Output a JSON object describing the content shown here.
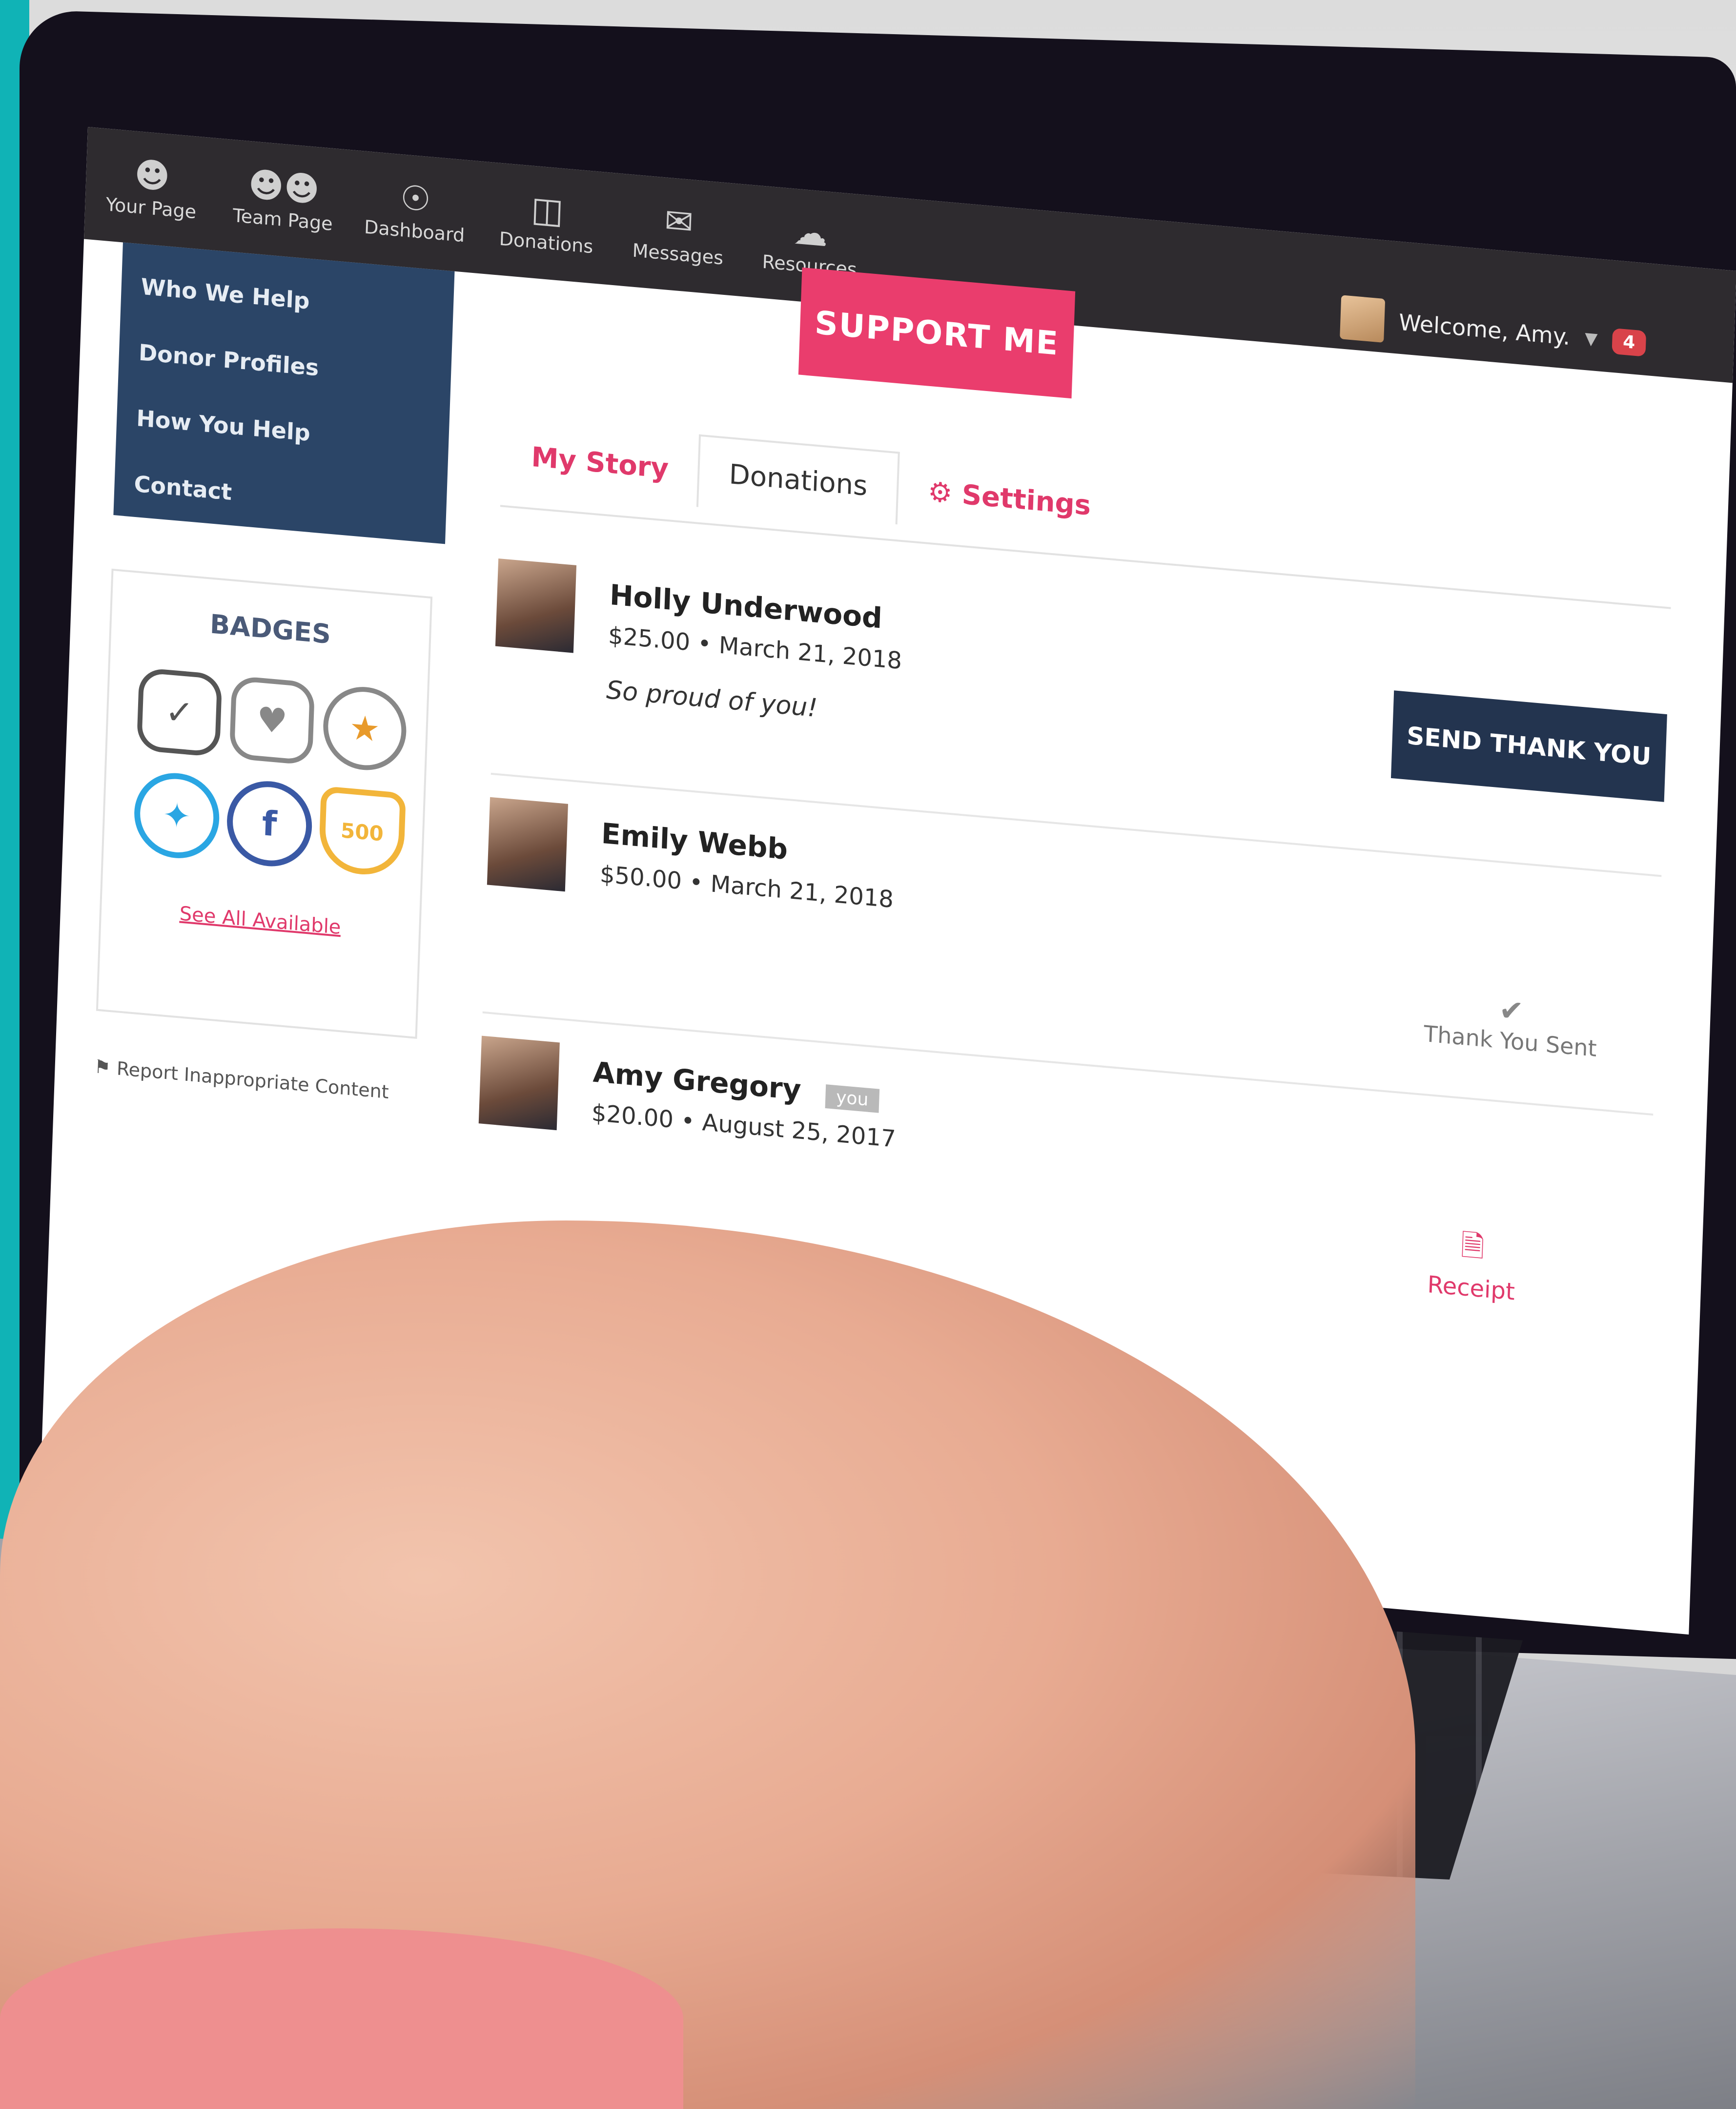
{
  "topnav": {
    "items": [
      {
        "label": "Your Page",
        "icon": "user-icon"
      },
      {
        "label": "Team Page",
        "icon": "team-icon"
      },
      {
        "label": "Dashboard",
        "icon": "dashboard-icon"
      },
      {
        "label": "Donations",
        "icon": "gift-icon"
      },
      {
        "label": "Messages",
        "icon": "envelope-icon"
      },
      {
        "label": "Resources",
        "icon": "cloud-download-icon"
      }
    ],
    "welcome": "Welcome, Amy.",
    "notification_count": "4"
  },
  "sidebar": {
    "items": [
      "Who We Help",
      "Donor Profiles",
      "How You Help",
      "Contact"
    ]
  },
  "badges": {
    "title": "BADGES",
    "items": [
      "check-badge",
      "heart-badge",
      "star-ribbon-badge",
      "twitter-badge",
      "facebook-badge",
      "500-badge"
    ],
    "badge_500_label": "500",
    "see_all": "See All Available"
  },
  "report": "Report Inappropriate Content",
  "support_button": "SUPPORT ME",
  "tabs": [
    "My Story",
    "Donations",
    "Settings"
  ],
  "donations": [
    {
      "name": "Holly Underwood",
      "meta": "$25.00 • March 21, 2018",
      "message": "So proud of you!",
      "action": "SEND THANK YOU"
    },
    {
      "name": "Emily Webb",
      "meta": "$50.00 • March 21, 2018",
      "status": "Thank You Sent"
    },
    {
      "name": "Amy Gregory",
      "tag": "you",
      "meta": "$20.00 • August 25, 2017",
      "action": "Receipt"
    }
  ],
  "colors": {
    "accent_pink": "#ea3d6d",
    "navy": "#23344f",
    "nav_dark": "#2e2b2f",
    "sidebar_blue": "#2b4567",
    "teal_background": "#10b3b6"
  }
}
